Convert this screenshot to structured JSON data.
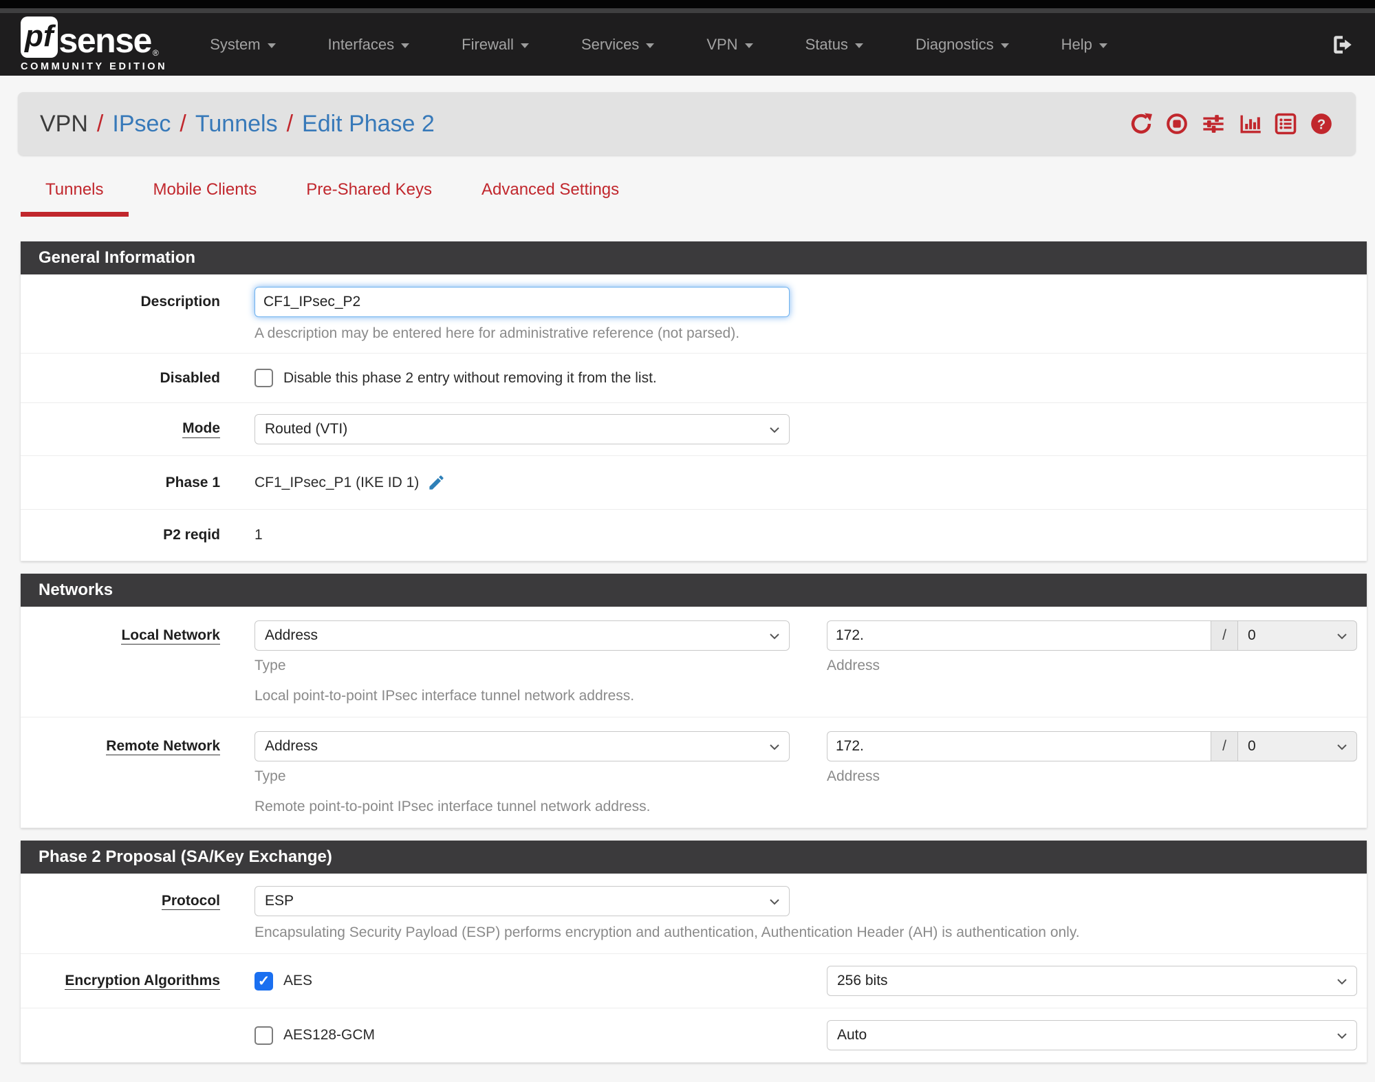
{
  "navbar": {
    "logo": {
      "pf": "pf",
      "sense": "sense",
      "registered": "®",
      "subtitle": "COMMUNITY EDITION"
    },
    "items": [
      {
        "label": "System"
      },
      {
        "label": "Interfaces"
      },
      {
        "label": "Firewall"
      },
      {
        "label": "Services"
      },
      {
        "label": "VPN"
      },
      {
        "label": "Status"
      },
      {
        "label": "Diagnostics"
      },
      {
        "label": "Help"
      }
    ]
  },
  "breadcrumb": {
    "separator": "/",
    "items": [
      {
        "label": "VPN"
      },
      {
        "label": "IPsec"
      },
      {
        "label": "Tunnels"
      },
      {
        "label": "Edit Phase 2"
      }
    ]
  },
  "tabs": [
    {
      "label": "Tunnels"
    },
    {
      "label": "Mobile Clients"
    },
    {
      "label": "Pre-Shared Keys"
    },
    {
      "label": "Advanced Settings"
    }
  ],
  "general": {
    "title": "General Information",
    "description": {
      "label": "Description",
      "value": "CF1_IPsec_P2",
      "help": "A description may be entered here for administrative reference (not parsed)."
    },
    "disabled": {
      "label": "Disabled",
      "checkbox_label": "Disable this phase 2 entry without removing it from the list.",
      "checked": false
    },
    "mode": {
      "label": "Mode",
      "value": "Routed (VTI)"
    },
    "phase1": {
      "label": "Phase 1",
      "value": "CF1_IPsec_P1 (IKE ID 1)"
    },
    "p2reqid": {
      "label": "P2 reqid",
      "value": "1"
    }
  },
  "networks": {
    "title": "Networks",
    "local": {
      "label": "Local Network",
      "type_value": "Address",
      "type_help": "Type",
      "address_value": "172.",
      "address_help": "Address",
      "cidr_separator": "/",
      "cidr_value": "0",
      "help": "Local point-to-point IPsec interface tunnel network address."
    },
    "remote": {
      "label": "Remote Network",
      "type_value": "Address",
      "type_help": "Type",
      "address_value": "172.",
      "address_help": "Address",
      "cidr_separator": "/",
      "cidr_value": "0",
      "help": "Remote point-to-point IPsec interface tunnel network address."
    }
  },
  "proposal": {
    "title": "Phase 2 Proposal (SA/Key Exchange)",
    "protocol": {
      "label": "Protocol",
      "value": "ESP",
      "help": "Encapsulating Security Payload (ESP) performs encryption and authentication, Authentication Header (AH) is authentication only."
    },
    "encryption": {
      "label": "Encryption Algorithms",
      "algorithms": [
        {
          "name": "AES",
          "checked": true,
          "key_length": "256 bits"
        },
        {
          "name": "AES128-GCM",
          "checked": false,
          "key_length": "Auto"
        }
      ]
    }
  },
  "colors": {
    "accent_red": "#c1272d",
    "link_blue": "#3779b9",
    "panel_header": "#3b3a3c",
    "checkbox_blue": "#1a6ff0"
  }
}
